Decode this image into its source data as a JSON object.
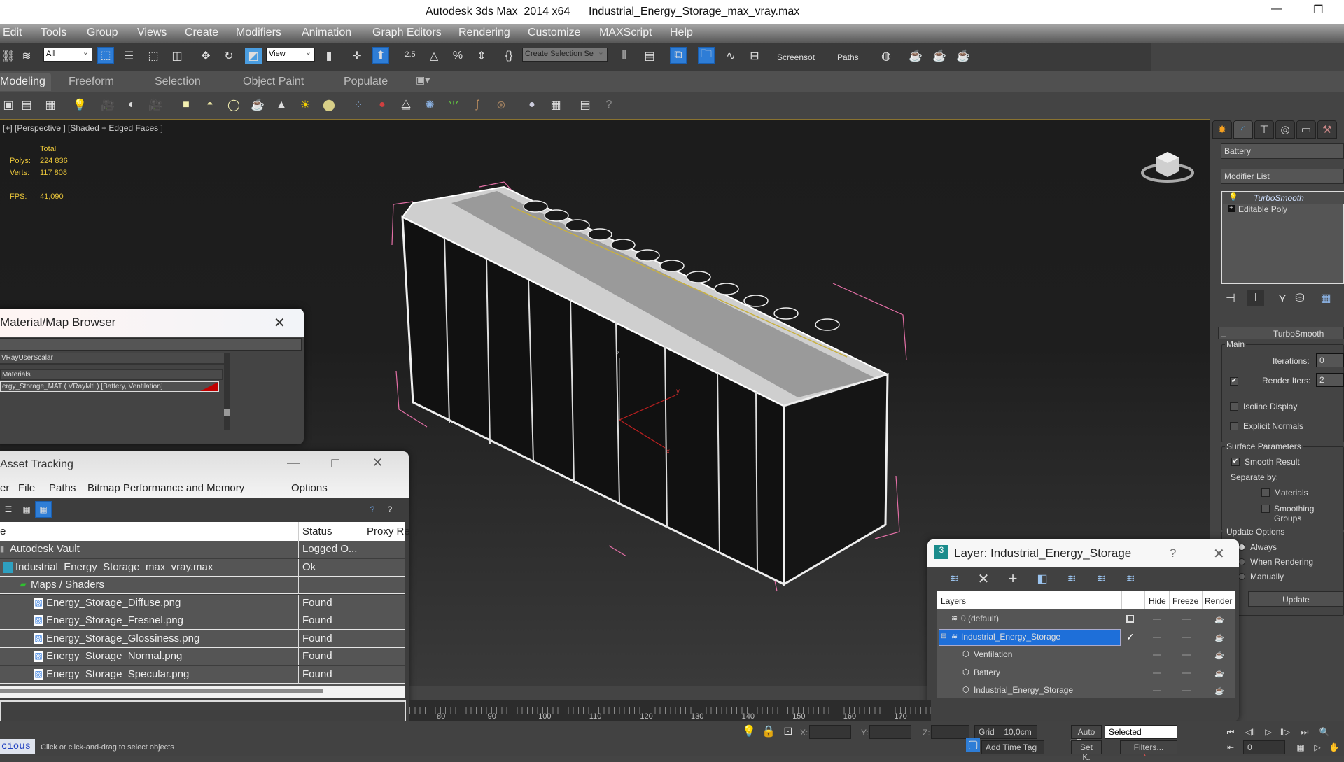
{
  "window": {
    "app_title": "Autodesk 3ds Max  2014 x64",
    "file_name": "Industrial_Energy_Storage_max_vray.max",
    "minimize": "—",
    "restore": "❐"
  },
  "menu": [
    "Edit",
    "Tools",
    "Group",
    "Views",
    "Create",
    "Modifiers",
    "Animation",
    "Graph Editors",
    "Rendering",
    "Customize",
    "MAXScript",
    "Help"
  ],
  "toolbar": {
    "selection_filter": "All",
    "reference_coord": "View",
    "snap_angle_label": "2.5",
    "named_selection_placeholder": "Create Selection Se",
    "screenshot_label": "Screensot",
    "paths_label": "Paths"
  },
  "ribbon": {
    "tabs": [
      "Modeling",
      "Freeform",
      "Selection",
      "Object Paint",
      "Populate"
    ],
    "active_tab": "Modeling"
  },
  "viewport": {
    "label": "[+] [Perspective ] [Shaded + Edged Faces ]",
    "stats": {
      "header": "Total",
      "polys_label": "Polys:",
      "polys_value": "224 836",
      "verts_label": "Verts:",
      "verts_value": "117 808",
      "fps_label": "FPS:",
      "fps_value": "41,090"
    },
    "axis_labels": {
      "x": "x",
      "y": "y",
      "z": "z"
    }
  },
  "command_panel": {
    "object_name": "Battery",
    "modifier_list_label": "Modifier List",
    "stack": [
      "TurboSmooth",
      "Editable Poly"
    ],
    "rollout_title": "TurboSmooth",
    "main": {
      "group": "Main",
      "iterations_label": "Iterations:",
      "iterations_value": "0",
      "render_iters_label": "Render Iters:",
      "render_iters_value": "2",
      "render_iters_checked": true,
      "isoline_label": "Isoline Display",
      "isoline_checked": false,
      "explicit_normals_label": "Explicit Normals",
      "explicit_normals_checked": false
    },
    "surface": {
      "group": "Surface Parameters",
      "smooth_result_label": "Smooth Result",
      "smooth_result_checked": true,
      "separate_by_label": "Separate by:",
      "materials_label": "Materials",
      "smoothing_groups_label": "Smoothing Groups"
    },
    "update": {
      "group": "Update Options",
      "options": [
        "Always",
        "When Rendering",
        "Manually"
      ],
      "selected": "Always",
      "button": "Update"
    }
  },
  "material_browser": {
    "title": "Material/Map Browser",
    "items": [
      {
        "label": "VRayUserScalar"
      },
      {
        "label": "Materials"
      },
      {
        "label": "ergy_Storage_MAT ( VRayMtl ) [Battery, Ventilation]"
      }
    ],
    "accent": "#c00000"
  },
  "asset_tracking": {
    "title": "Asset Tracking",
    "menu": [
      "er",
      "File",
      "Paths",
      "Bitmap Performance and Memory",
      "Options"
    ],
    "columns": [
      "e",
      "Status",
      "Proxy Re"
    ],
    "rows": [
      {
        "name": "Autodesk Vault",
        "status": "Logged O...",
        "indent": 0
      },
      {
        "name": "Industrial_Energy_Storage_max_vray.max",
        "status": "Ok",
        "indent": 1
      },
      {
        "name": "Maps / Shaders",
        "status": "",
        "indent": 2
      },
      {
        "name": "Energy_Storage_Diffuse.png",
        "status": "Found",
        "indent": 3
      },
      {
        "name": "Energy_Storage_Fresnel.png",
        "status": "Found",
        "indent": 3
      },
      {
        "name": "Energy_Storage_Glossiness.png",
        "status": "Found",
        "indent": 3
      },
      {
        "name": "Energy_Storage_Normal.png",
        "status": "Found",
        "indent": 3
      },
      {
        "name": "Energy_Storage_Specular.png",
        "status": "Found",
        "indent": 3
      }
    ]
  },
  "layer_dialog": {
    "title": "Layer: Industrial_Energy_Storage",
    "help": "?",
    "columns": [
      "Layers",
      "Hide",
      "Freeze",
      "Render"
    ],
    "rows": [
      {
        "name": "0 (default)",
        "type": "layer",
        "selected": false,
        "current": false
      },
      {
        "name": "Industrial_Energy_Storage",
        "type": "layer",
        "selected": true,
        "current": true
      },
      {
        "name": "Ventilation",
        "type": "object",
        "selected": false
      },
      {
        "name": "Battery",
        "type": "object",
        "selected": false
      },
      {
        "name": "Industrial_Energy_Storage",
        "type": "object",
        "selected": false
      }
    ],
    "selection_color": "#1e6fd9"
  },
  "timeline": {
    "ticks": [
      "80",
      "90",
      "100",
      "110",
      "120",
      "130",
      "140",
      "150",
      "160",
      "170"
    ]
  },
  "status": {
    "script_listener": "cious",
    "prompt": "Click or click-and-drag to select objects",
    "x_label": "X:",
    "y_label": "Y:",
    "z_label": "Z:",
    "grid": "Grid = 10,0cm",
    "add_time_tag": "Add Time Tag",
    "auto_key": "Auto",
    "set_key": "Set K.",
    "key_filter": "Selected",
    "filters": "Filters...",
    "current_frame": "0"
  }
}
